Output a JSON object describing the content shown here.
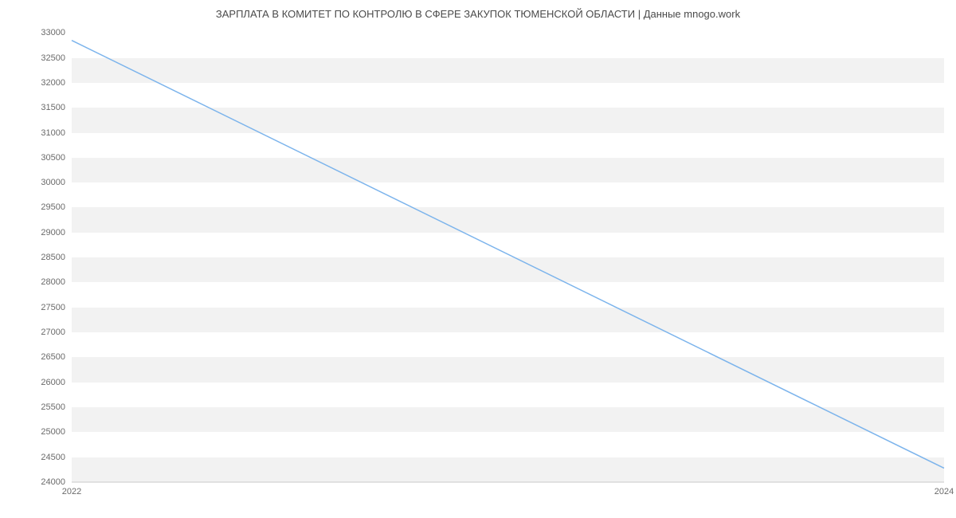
{
  "chart_data": {
    "type": "line",
    "title": "ЗАРПЛАТА В КОМИТЕТ ПО КОНТРОЛЮ В СФЕРЕ ЗАКУПОК ТЮМЕНСКОЙ ОБЛАСТИ | Данные mnogo.work",
    "xlabel": "",
    "ylabel": "",
    "x": [
      2022,
      2024
    ],
    "values": [
      32850,
      24280
    ],
    "ylim": [
      24000,
      33100
    ],
    "xlim": [
      2022,
      2024
    ],
    "y_ticks": [
      24000,
      24500,
      25000,
      25500,
      26000,
      26500,
      27000,
      27500,
      28000,
      28500,
      29000,
      29500,
      30000,
      30500,
      31000,
      31500,
      32000,
      32500,
      33000
    ],
    "x_ticks": [
      2022,
      2024
    ],
    "grid": true,
    "line_color": "#7cb4ec"
  }
}
